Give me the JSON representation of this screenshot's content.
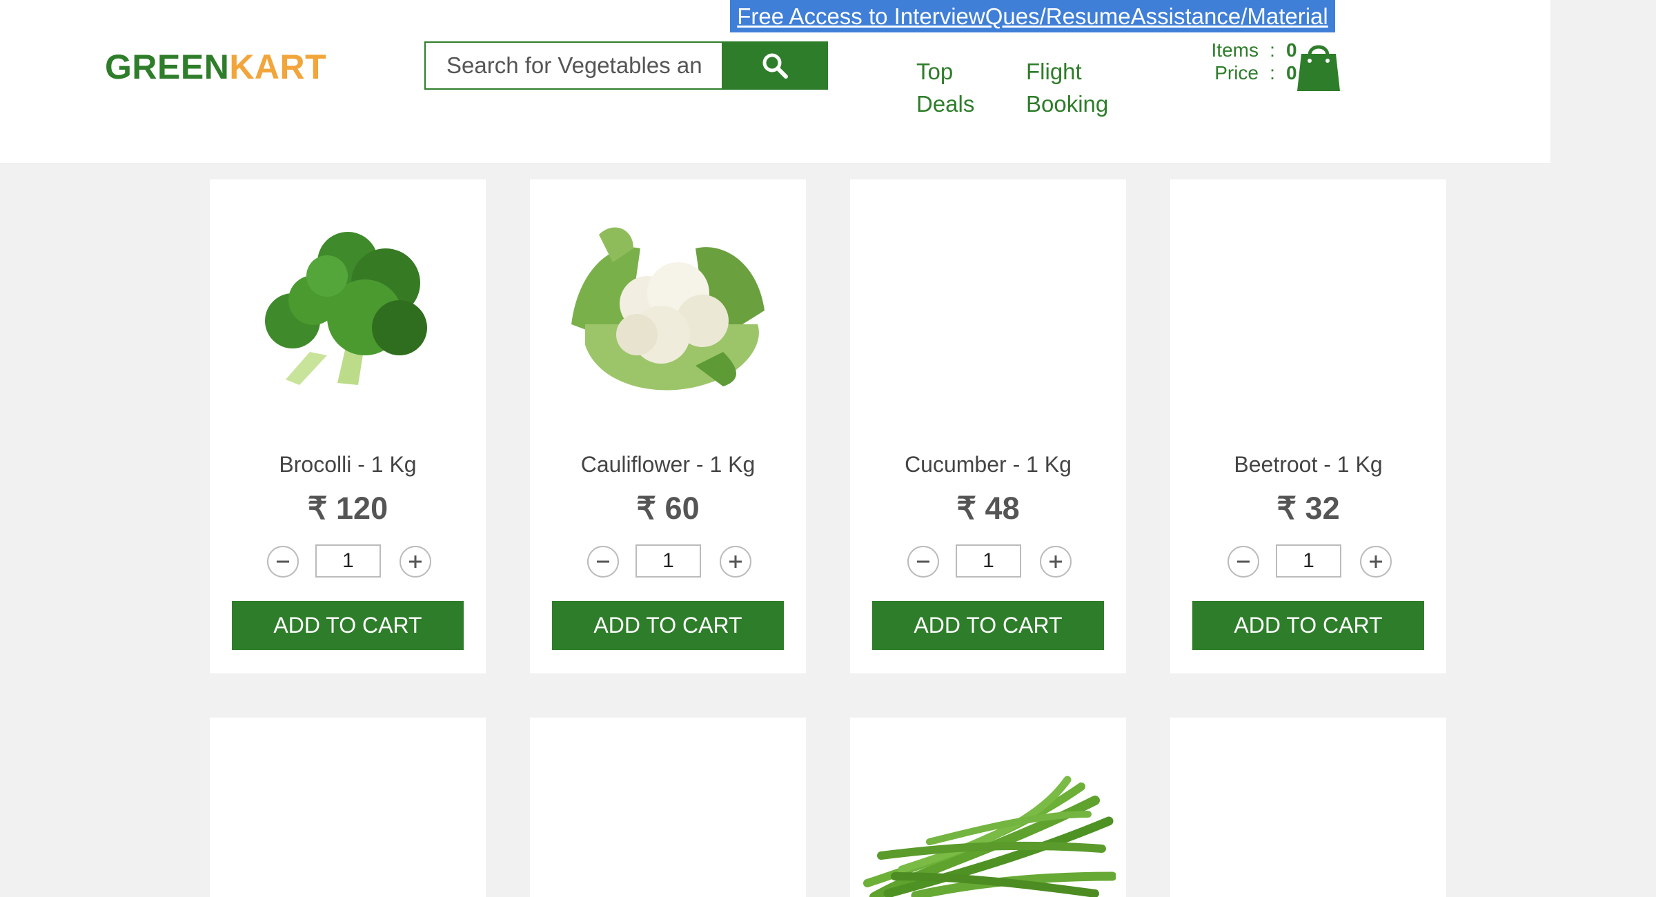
{
  "header": {
    "promo_link": "Free Access to InterviewQues/ResumeAssistance/Material",
    "logo_part1": "GREEN",
    "logo_part2": "KART",
    "search_placeholder": "Search for Vegetables an",
    "nav": [
      {
        "line1": "Top",
        "line2": "Deals"
      },
      {
        "line1": "Flight",
        "line2": "Booking"
      }
    ],
    "cart": {
      "items_label": "Items",
      "items_value": "0",
      "price_label": "Price",
      "price_value": "0",
      "separator": ":"
    }
  },
  "products": [
    {
      "name": "Brocolli - 1 Kg",
      "price": "₹ 120",
      "qty": "1",
      "button": "ADD TO CART",
      "image": "broccoli"
    },
    {
      "name": "Cauliflower - 1 Kg",
      "price": "₹ 60",
      "qty": "1",
      "button": "ADD TO CART",
      "image": "cauliflower"
    },
    {
      "name": "Cucumber - 1 Kg",
      "price": "₹ 48",
      "qty": "1",
      "button": "ADD TO CART",
      "image": "blank"
    },
    {
      "name": "Beetroot - 1 Kg",
      "price": "₹ 32",
      "qty": "1",
      "button": "ADD TO CART",
      "image": "blank"
    }
  ],
  "second_row": [
    {
      "image": "blank"
    },
    {
      "image": "blank"
    },
    {
      "image": "green-beans"
    },
    {
      "image": "blank"
    }
  ],
  "colors": {
    "brand_green": "#2e7d2a",
    "brand_orange": "#f1a53a",
    "promo_blue": "#3f7fd8"
  }
}
